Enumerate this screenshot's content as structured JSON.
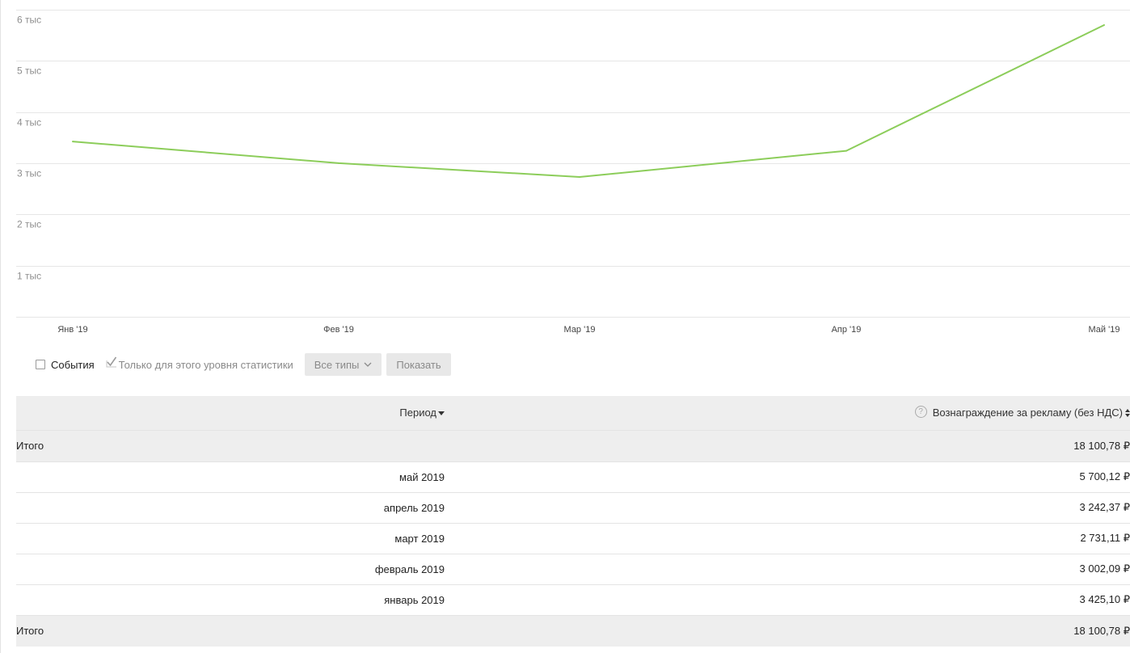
{
  "chart_data": {
    "type": "line",
    "categories": [
      "Янв '19",
      "Фев '19",
      "Мар '19",
      "Апр '19",
      "Май '19"
    ],
    "series": [
      {
        "values": [
          3425.1,
          3002.09,
          2731.11,
          3242.37,
          5700.12
        ]
      }
    ],
    "yticks": [
      {
        "value": 1000,
        "label": "1 тыс"
      },
      {
        "value": 2000,
        "label": "2 тыс"
      },
      {
        "value": 3000,
        "label": "3 тыс"
      },
      {
        "value": 4000,
        "label": "4 тыс"
      },
      {
        "value": 5000,
        "label": "5 тыс"
      },
      {
        "value": 6000,
        "label": "6 тыс"
      }
    ],
    "ylim": [
      0,
      6000
    ],
    "grid": true,
    "line_color": "#8ccd5a",
    "grid_color": "#e6e6e6"
  },
  "controls": {
    "events_label": "События",
    "level_only_label": "Только для этого уровня статистики",
    "types_select": "Все типы",
    "show_button": "Показать"
  },
  "table": {
    "header_period": "Период",
    "header_reward": "Вознаграждение за рекламу (без НДС)",
    "help_icon": "?",
    "total_label": "Итого",
    "total_value": "18 100,78 ₽",
    "rows": [
      {
        "period": "май 2019",
        "value": "5 700,12 ₽"
      },
      {
        "period": "апрель 2019",
        "value": "3 242,37 ₽"
      },
      {
        "period": "март 2019",
        "value": "2 731,11 ₽"
      },
      {
        "period": "февраль 2019",
        "value": "3 002,09 ₽"
      },
      {
        "period": "январь 2019",
        "value": "3 425,10 ₽"
      }
    ]
  }
}
